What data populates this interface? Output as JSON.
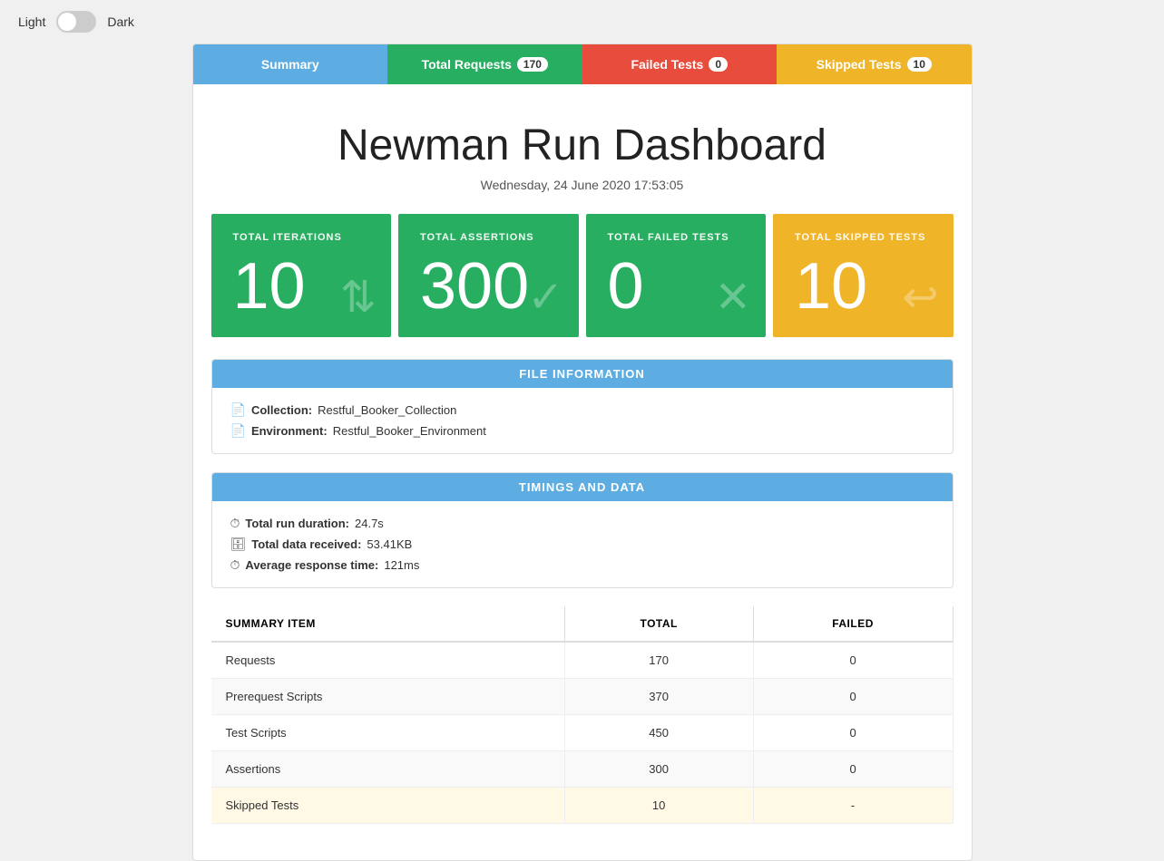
{
  "topbar": {
    "light_label": "Light",
    "dark_label": "Dark"
  },
  "tabs": [
    {
      "key": "summary",
      "label": "Summary",
      "badge": null,
      "class": "tab-summary"
    },
    {
      "key": "total-requests",
      "label": "Total Requests",
      "badge": "170",
      "class": "tab-total-requests"
    },
    {
      "key": "failed-tests",
      "label": "Failed Tests",
      "badge": "0",
      "class": "tab-failed-tests"
    },
    {
      "key": "skipped-tests",
      "label": "Skipped Tests",
      "badge": "10",
      "class": "tab-skipped-tests"
    }
  ],
  "dashboard": {
    "title": "Newman Run Dashboard",
    "date": "Wednesday, 24 June 2020 17:53:05"
  },
  "stats": [
    {
      "key": "iterations",
      "label": "TOTAL ITERATIONS",
      "value": "10",
      "icon": "↕",
      "class": "stat-card-green"
    },
    {
      "key": "assertions",
      "label": "TOTAL ASSERTIONS",
      "value": "300",
      "icon": "✓",
      "class": "stat-card-green"
    },
    {
      "key": "failed",
      "label": "TOTAL FAILED TESTS",
      "value": "0",
      "icon": "✕",
      "class": "stat-card-failed"
    },
    {
      "key": "skipped",
      "label": "TOTAL SKIPPED TESTS",
      "value": "10",
      "icon": "↩",
      "class": "stat-card-yellow"
    }
  ],
  "file_info": {
    "header": "FILE INFORMATION",
    "collection_label": "Collection:",
    "collection_value": "Restful_Booker_Collection",
    "environment_label": "Environment:",
    "environment_value": "Restful_Booker_Environment"
  },
  "timings": {
    "header": "TIMINGS AND DATA",
    "duration_label": "Total run duration:",
    "duration_value": "24.7s",
    "data_label": "Total data received:",
    "data_value": "53.41KB",
    "response_label": "Average response time:",
    "response_value": "121ms"
  },
  "summary_table": {
    "col_item": "SUMMARY ITEM",
    "col_total": "TOTAL",
    "col_failed": "FAILED",
    "rows": [
      {
        "item": "Requests",
        "total": "170",
        "failed": "0",
        "skipped": false
      },
      {
        "item": "Prerequest Scripts",
        "total": "370",
        "failed": "0",
        "skipped": false
      },
      {
        "item": "Test Scripts",
        "total": "450",
        "failed": "0",
        "skipped": false
      },
      {
        "item": "Assertions",
        "total": "300",
        "failed": "0",
        "skipped": false
      },
      {
        "item": "Skipped Tests",
        "total": "10",
        "failed": "-",
        "skipped": true
      }
    ]
  }
}
